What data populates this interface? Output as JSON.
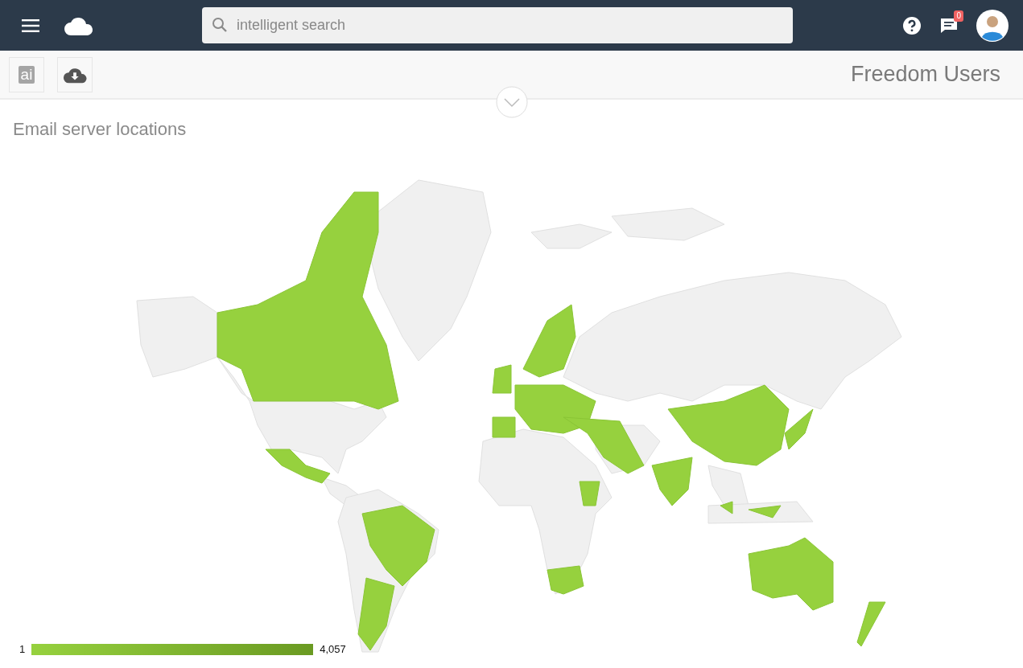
{
  "search": {
    "placeholder": "intelligent search"
  },
  "notifications": {
    "count": "0"
  },
  "toolbar": {
    "ai_badge": "ai",
    "title": "Freedom Users"
  },
  "map": {
    "title": "Email server locations",
    "legend_min": "1",
    "legend_max": "4,057"
  }
}
